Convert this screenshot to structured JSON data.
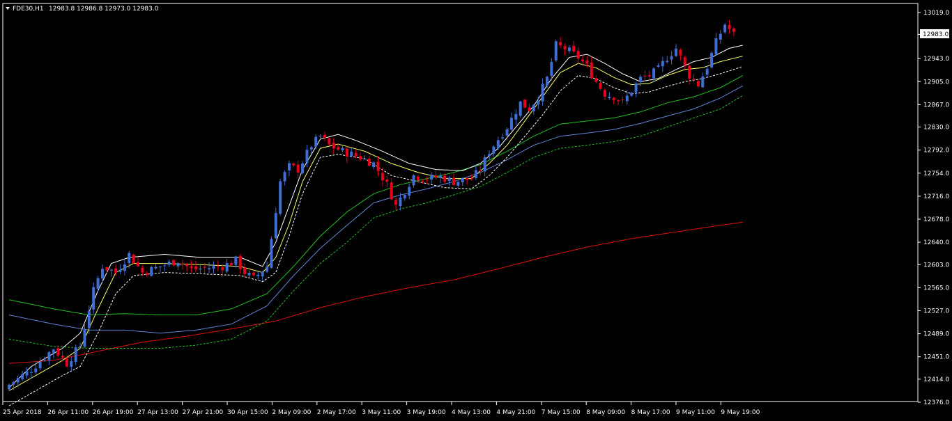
{
  "header": {
    "symbol": "FDE30,H1",
    "ohlc": "12983.8 12986.8 12973.0 12983.0"
  },
  "colors": {
    "background": "#000000",
    "bull": "#3f6fd6",
    "bear": "#e8001c",
    "frame": "#ffffff",
    "ma_white": "#ffffff",
    "ma_yellow": "#ffff66",
    "ma_green": "#22c022",
    "ma_blue": "#5f86d6",
    "ma_red": "#e01010"
  },
  "chart_data": {
    "type": "candlestick",
    "title": "FDE30,H1",
    "price_ticks": [
      13019.0,
      12983.0,
      12943.0,
      12905.0,
      12867.0,
      12830.0,
      12792.0,
      12754.0,
      12716.0,
      12678.0,
      12640.0,
      12603.0,
      12565.0,
      12527.0,
      12489.0,
      12451.0,
      12414.0,
      12376.0
    ],
    "current_price": "12983.0",
    "time_labels": [
      "25 Apr 2018",
      "26 Apr 11:00",
      "26 Apr 19:00",
      "27 Apr 13:00",
      "27 Apr 21:00",
      "30 Apr 15:00",
      "2 May 09:00",
      "2 May 17:00",
      "3 May 11:00",
      "3 May 19:00",
      "4 May 13:00",
      "4 May 21:00",
      "7 May 15:00",
      "8 May 09:00",
      "8 May 17:00",
      "9 May 11:00",
      "9 May 19:00"
    ],
    "ylim": [
      12376.0,
      13019.0
    ],
    "close_path": [
      [
        0,
        12405
      ],
      [
        5,
        12430
      ],
      [
        10,
        12465
      ],
      [
        13,
        12440
      ],
      [
        16,
        12470
      ],
      [
        19,
        12560
      ],
      [
        21,
        12600
      ],
      [
        24,
        12590
      ],
      [
        27,
        12620
      ],
      [
        30,
        12590
      ],
      [
        34,
        12600
      ],
      [
        38,
        12610
      ],
      [
        41,
        12595
      ],
      [
        45,
        12598
      ],
      [
        48,
        12600
      ],
      [
        51,
        12610
      ],
      [
        53,
        12590
      ],
      [
        55,
        12580
      ],
      [
        58,
        12600
      ],
      [
        61,
        12740
      ],
      [
        63,
        12765
      ],
      [
        65,
        12760
      ],
      [
        68,
        12800
      ],
      [
        70,
        12815
      ],
      [
        72,
        12800
      ],
      [
        75,
        12790
      ],
      [
        79,
        12780
      ],
      [
        82,
        12770
      ],
      [
        85,
        12735
      ],
      [
        87,
        12700
      ],
      [
        89,
        12725
      ],
      [
        91,
        12750
      ],
      [
        94,
        12745
      ],
      [
        97,
        12748
      ],
      [
        100,
        12740
      ],
      [
        104,
        12745
      ],
      [
        106,
        12760
      ],
      [
        108,
        12790
      ],
      [
        110,
        12810
      ],
      [
        112,
        12830
      ],
      [
        115,
        12870
      ],
      [
        117,
        12860
      ],
      [
        119,
        12880
      ],
      [
        121,
        12910
      ],
      [
        123,
        12965
      ],
      [
        125,
        12960
      ],
      [
        128,
        12945
      ],
      [
        130,
        12930
      ],
      [
        132,
        12905
      ],
      [
        134,
        12885
      ],
      [
        136,
        12880
      ],
      [
        138,
        12870
      ],
      [
        140,
        12890
      ],
      [
        142,
        12910
      ],
      [
        144,
        12915
      ],
      [
        146,
        12925
      ],
      [
        148,
        12945
      ],
      [
        150,
        12960
      ],
      [
        152,
        12930
      ],
      [
        153,
        12915
      ],
      [
        155,
        12900
      ],
      [
        157,
        12930
      ],
      [
        159,
        12970
      ],
      [
        161,
        13000
      ],
      [
        163,
        12983
      ]
    ],
    "ma_white_points": [
      [
        0,
        12400
      ],
      [
        5,
        12435
      ],
      [
        12,
        12465
      ],
      [
        16,
        12490
      ],
      [
        20,
        12560
      ],
      [
        23,
        12605
      ],
      [
        27,
        12615
      ],
      [
        35,
        12620
      ],
      [
        43,
        12615
      ],
      [
        52,
        12615
      ],
      [
        57,
        12600
      ],
      [
        60,
        12640
      ],
      [
        63,
        12700
      ],
      [
        66,
        12760
      ],
      [
        70,
        12810
      ],
      [
        74,
        12818
      ],
      [
        78,
        12808
      ],
      [
        84,
        12790
      ],
      [
        90,
        12770
      ],
      [
        96,
        12760
      ],
      [
        102,
        12758
      ],
      [
        106,
        12770
      ],
      [
        110,
        12795
      ],
      [
        114,
        12830
      ],
      [
        118,
        12865
      ],
      [
        122,
        12910
      ],
      [
        126,
        12945
      ],
      [
        130,
        12950
      ],
      [
        134,
        12935
      ],
      [
        138,
        12918
      ],
      [
        142,
        12905
      ],
      [
        146,
        12910
      ],
      [
        150,
        12925
      ],
      [
        154,
        12938
      ],
      [
        158,
        12945
      ],
      [
        162,
        12960
      ],
      [
        165,
        12965
      ]
    ],
    "ma_yellow_points": [
      [
        0,
        12395
      ],
      [
        6,
        12420
      ],
      [
        12,
        12445
      ],
      [
        16,
        12465
      ],
      [
        20,
        12530
      ],
      [
        24,
        12590
      ],
      [
        28,
        12605
      ],
      [
        35,
        12605
      ],
      [
        43,
        12603
      ],
      [
        52,
        12600
      ],
      [
        57,
        12590
      ],
      [
        60,
        12615
      ],
      [
        63,
        12670
      ],
      [
        66,
        12740
      ],
      [
        70,
        12795
      ],
      [
        74,
        12802
      ],
      [
        80,
        12790
      ],
      [
        86,
        12770
      ],
      [
        92,
        12755
      ],
      [
        98,
        12745
      ],
      [
        104,
        12745
      ],
      [
        108,
        12770
      ],
      [
        112,
        12800
      ],
      [
        116,
        12840
      ],
      [
        120,
        12880
      ],
      [
        124,
        12920
      ],
      [
        128,
        12935
      ],
      [
        132,
        12928
      ],
      [
        136,
        12912
      ],
      [
        140,
        12900
      ],
      [
        144,
        12902
      ],
      [
        148,
        12915
      ],
      [
        152,
        12925
      ],
      [
        156,
        12928
      ],
      [
        160,
        12938
      ],
      [
        165,
        12947
      ]
    ],
    "ma_dash_points": [
      [
        0,
        12370
      ],
      [
        6,
        12395
      ],
      [
        12,
        12420
      ],
      [
        16,
        12435
      ],
      [
        20,
        12490
      ],
      [
        24,
        12555
      ],
      [
        28,
        12585
      ],
      [
        35,
        12590
      ],
      [
        43,
        12588
      ],
      [
        52,
        12585
      ],
      [
        57,
        12575
      ],
      [
        60,
        12590
      ],
      [
        63,
        12650
      ],
      [
        66,
        12720
      ],
      [
        70,
        12780
      ],
      [
        74,
        12785
      ],
      [
        80,
        12778
      ],
      [
        86,
        12750
      ],
      [
        92,
        12740
      ],
      [
        98,
        12730
      ],
      [
        104,
        12728
      ],
      [
        108,
        12750
      ],
      [
        112,
        12780
      ],
      [
        116,
        12815
      ],
      [
        120,
        12850
      ],
      [
        124,
        12890
      ],
      [
        128,
        12915
      ],
      [
        132,
        12910
      ],
      [
        136,
        12895
      ],
      [
        140,
        12885
      ],
      [
        144,
        12888
      ],
      [
        148,
        12897
      ],
      [
        152,
        12905
      ],
      [
        156,
        12910
      ],
      [
        160,
        12918
      ],
      [
        165,
        12930
      ]
    ],
    "ma_green_points": [
      [
        0,
        12545
      ],
      [
        10,
        12530
      ],
      [
        18,
        12520
      ],
      [
        26,
        12522
      ],
      [
        34,
        12520
      ],
      [
        42,
        12520
      ],
      [
        50,
        12530
      ],
      [
        58,
        12555
      ],
      [
        64,
        12600
      ],
      [
        70,
        12650
      ],
      [
        76,
        12690
      ],
      [
        82,
        12720
      ],
      [
        88,
        12735
      ],
      [
        94,
        12745
      ],
      [
        100,
        12755
      ],
      [
        106,
        12768
      ],
      [
        112,
        12790
      ],
      [
        118,
        12815
      ],
      [
        124,
        12835
      ],
      [
        130,
        12840
      ],
      [
        136,
        12845
      ],
      [
        142,
        12855
      ],
      [
        148,
        12870
      ],
      [
        154,
        12880
      ],
      [
        160,
        12895
      ],
      [
        165,
        12915
      ]
    ],
    "ma_blue_points": [
      [
        0,
        12520
      ],
      [
        10,
        12505
      ],
      [
        18,
        12495
      ],
      [
        26,
        12495
      ],
      [
        34,
        12490
      ],
      [
        42,
        12495
      ],
      [
        50,
        12505
      ],
      [
        58,
        12535
      ],
      [
        64,
        12585
      ],
      [
        70,
        12630
      ],
      [
        76,
        12668
      ],
      [
        82,
        12705
      ],
      [
        88,
        12718
      ],
      [
        94,
        12728
      ],
      [
        100,
        12740
      ],
      [
        106,
        12755
      ],
      [
        112,
        12776
      ],
      [
        118,
        12800
      ],
      [
        124,
        12815
      ],
      [
        130,
        12820
      ],
      [
        136,
        12826
      ],
      [
        142,
        12836
      ],
      [
        148,
        12848
      ],
      [
        154,
        12860
      ],
      [
        160,
        12878
      ],
      [
        165,
        12898
      ]
    ],
    "ma_green_dash_points": [
      [
        0,
        12480
      ],
      [
        10,
        12468
      ],
      [
        18,
        12465
      ],
      [
        26,
        12465
      ],
      [
        34,
        12465
      ],
      [
        42,
        12470
      ],
      [
        50,
        12480
      ],
      [
        58,
        12510
      ],
      [
        64,
        12560
      ],
      [
        70,
        12605
      ],
      [
        76,
        12640
      ],
      [
        82,
        12680
      ],
      [
        88,
        12695
      ],
      [
        94,
        12705
      ],
      [
        100,
        12718
      ],
      [
        106,
        12732
      ],
      [
        112,
        12755
      ],
      [
        118,
        12780
      ],
      [
        124,
        12795
      ],
      [
        130,
        12800
      ],
      [
        136,
        12806
      ],
      [
        142,
        12815
      ],
      [
        148,
        12830
      ],
      [
        154,
        12845
      ],
      [
        160,
        12860
      ],
      [
        165,
        12882
      ]
    ],
    "ma_red_points": [
      [
        0,
        12440
      ],
      [
        10,
        12445
      ],
      [
        20,
        12460
      ],
      [
        30,
        12475
      ],
      [
        40,
        12485
      ],
      [
        50,
        12497
      ],
      [
        60,
        12510
      ],
      [
        70,
        12532
      ],
      [
        80,
        12550
      ],
      [
        90,
        12565
      ],
      [
        100,
        12578
      ],
      [
        110,
        12596
      ],
      [
        120,
        12615
      ],
      [
        130,
        12632
      ],
      [
        140,
        12646
      ],
      [
        150,
        12657
      ],
      [
        160,
        12668
      ],
      [
        165,
        12673
      ]
    ]
  }
}
